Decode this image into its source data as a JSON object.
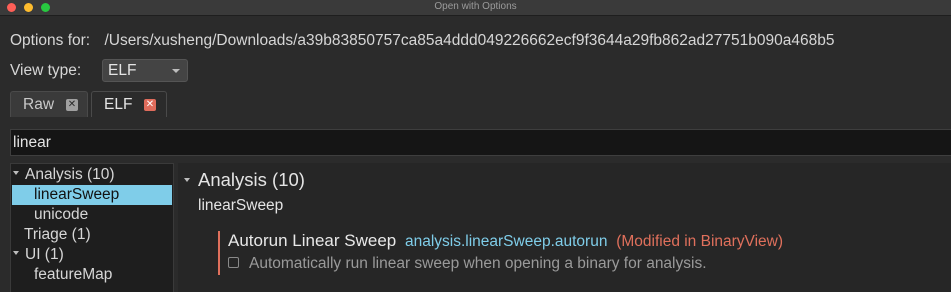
{
  "window": {
    "title": "Open with Options"
  },
  "options": {
    "label": "Options for:",
    "path": "/Users/xusheng/Downloads/a39b83850757ca85a4ddd049226662ecf9f3644a29fb862ad27751b090a468b5"
  },
  "view_type": {
    "label": "View type:",
    "selected": "ELF"
  },
  "tabs": [
    {
      "label": "Raw",
      "close": "✕"
    },
    {
      "label": "ELF",
      "close": "✕"
    }
  ],
  "search": {
    "value": "linear"
  },
  "tree": {
    "items": [
      {
        "label": "Analysis (10)"
      },
      {
        "label": "linearSweep"
      },
      {
        "label": "unicode"
      },
      {
        "label": "Triage (1)"
      },
      {
        "label": "UI (1)"
      },
      {
        "label": "featureMap"
      }
    ]
  },
  "detail": {
    "section": "Analysis (10)",
    "group": "linearSweep",
    "setting": {
      "title": "Autorun Linear Sweep",
      "key": "analysis.linearSweep.autorun",
      "modified": "(Modified in BinaryView)",
      "description": "Automatically run linear sweep when opening a binary for analysis."
    }
  },
  "colors": {
    "accent": "#7fcde9",
    "modified": "#e0705c"
  }
}
